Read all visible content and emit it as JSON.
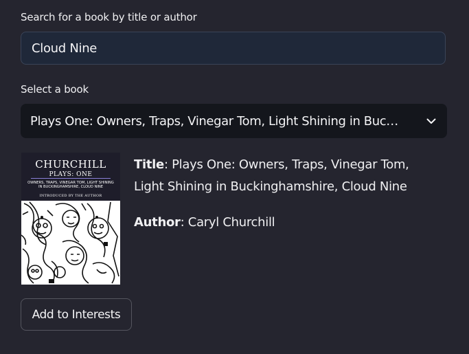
{
  "search": {
    "label": "Search for a book by title or author",
    "value": "Cloud Nine"
  },
  "select": {
    "label": "Select a book",
    "selected": "Plays One: Owners, Traps, Vinegar Tom, Light Shining in Buckin…"
  },
  "book": {
    "cover": {
      "author": "CHURCHILL",
      "volume": "PLAYS: ONE",
      "contents": "OWNERS, TRAPS, VINEGAR TOM, LIGHT SHINING IN BUCKINGHAMSHIRE, CLOUD NINE",
      "intro": "INTRODUCED BY THE AUTHOR"
    },
    "title_key": "Title",
    "title_value": ": Plays One: Owners, Traps, Vinegar Tom, Light Shining in Buckinghamshire, Cloud Nine",
    "author_key": "Author",
    "author_value": ": Caryl Churchill"
  },
  "actions": {
    "add_label": "Add to Interests"
  },
  "icons": {
    "dropdown": "chevron-down-icon"
  }
}
